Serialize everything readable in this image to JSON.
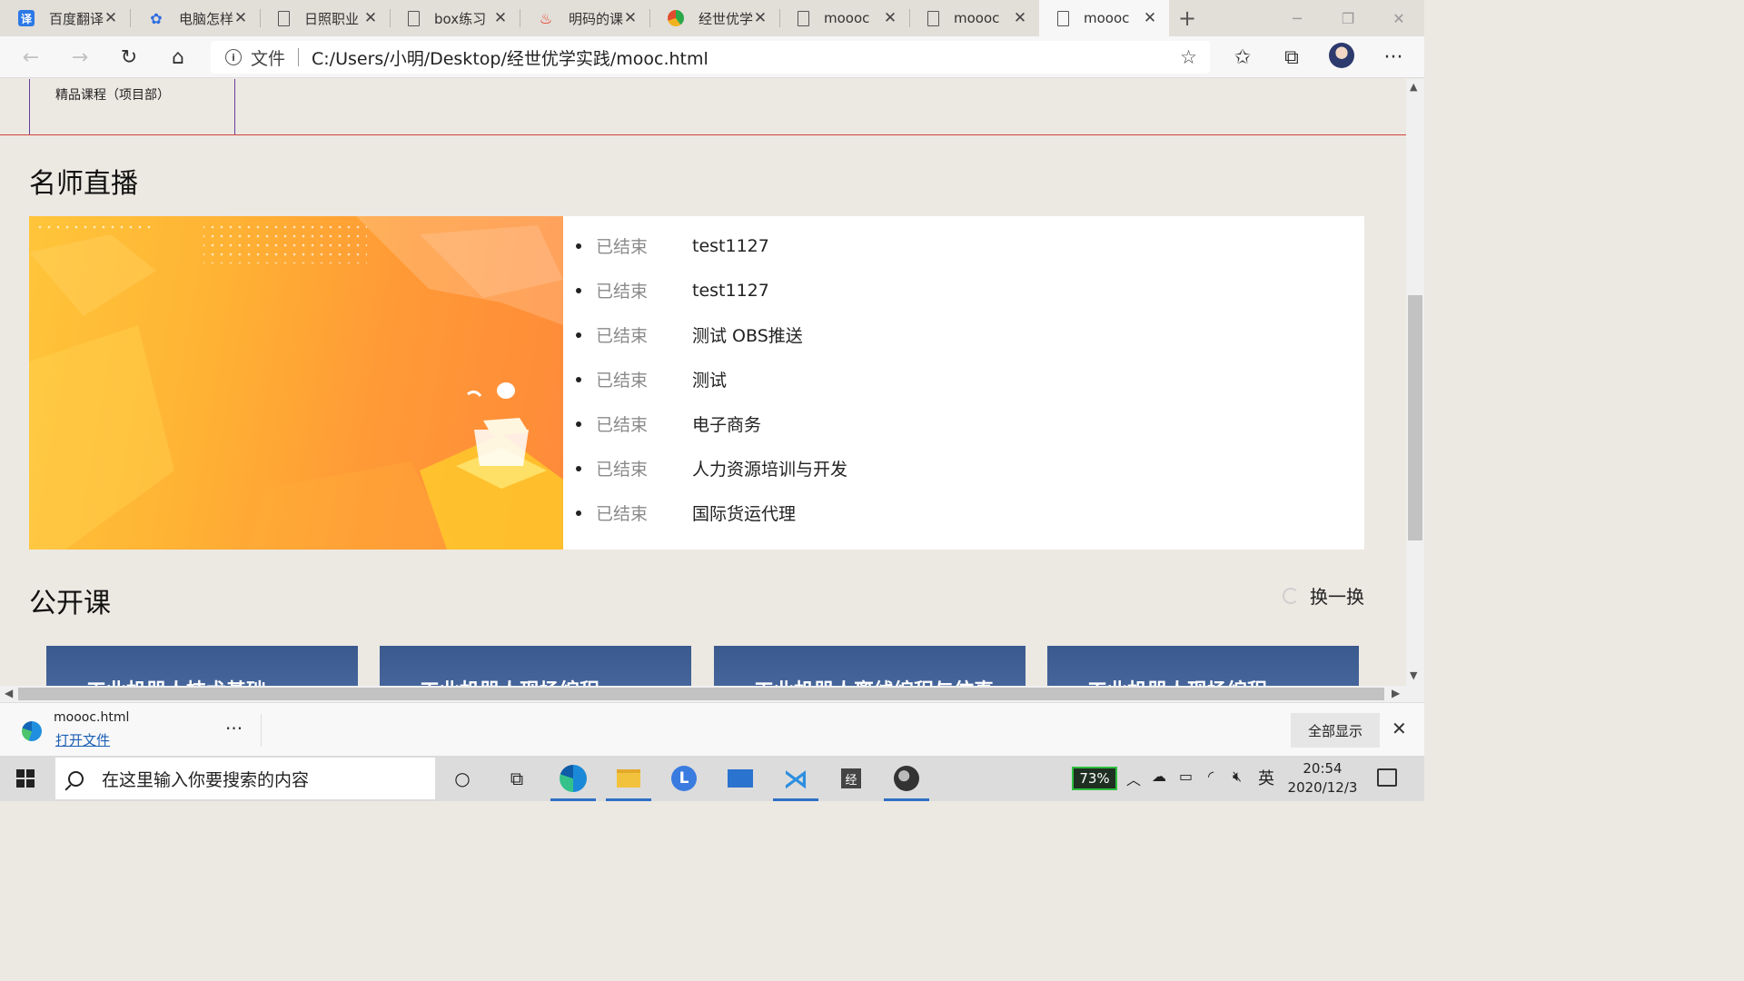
{
  "browser": {
    "tabs": [
      {
        "title": "百度翻译",
        "icon": "translate-icon"
      },
      {
        "title": "电脑怎样",
        "icon": "baidu-paw-icon"
      },
      {
        "title": "日照职业",
        "icon": "document-icon"
      },
      {
        "title": "box练习",
        "icon": "document-icon"
      },
      {
        "title": "明码的课",
        "icon": "fire-icon"
      },
      {
        "title": "经世优学",
        "icon": "swirl-logo-icon"
      },
      {
        "title": "moooc",
        "icon": "document-icon"
      },
      {
        "title": "moooc",
        "icon": "document-icon"
      },
      {
        "title": "moooc",
        "icon": "document-icon"
      }
    ],
    "new_tab_glyph": "+",
    "address": {
      "scheme_label": "文件",
      "url": "C:/Users/小明/Desktop/经世优学实践/mooc.html"
    }
  },
  "page": {
    "course_box_label": "精品课程（项目部）",
    "live_section_title": "名师直播",
    "live_items": [
      {
        "status": "已结束",
        "name": "test1127"
      },
      {
        "status": "已结束",
        "name": "test1127"
      },
      {
        "status": "已结束",
        "name": "测试 OBS推送"
      },
      {
        "status": "已结束",
        "name": "测试"
      },
      {
        "status": "已结束",
        "name": "电子商务"
      },
      {
        "status": "已结束",
        "name": "人力资源培训与开发"
      },
      {
        "status": "已结束",
        "name": "国际货运代理"
      }
    ],
    "open_section_title": "公开课",
    "refresh_label": "换一换",
    "cards": [
      {
        "title": "工业机器人技术基础"
      },
      {
        "title": "工业机器人现场编程"
      },
      {
        "title": "工业机器人离线编程与仿真"
      },
      {
        "title": "工业机器人现场编程"
      }
    ]
  },
  "download_bar": {
    "file_name": "moooc.html",
    "open_label": "打开文件",
    "more_glyph": "···",
    "show_all_label": "全部显示"
  },
  "taskbar": {
    "search_placeholder": "在这里输入你要搜索的内容",
    "battery_badge": "73%",
    "ime": "英",
    "time": "20:54",
    "date": "2020/12/3"
  },
  "colors": {
    "page_bg": "#ece8e2",
    "divider_red": "#d0443a",
    "course_box_border": "#6a3fa0",
    "banner_orange": "#ff9936"
  }
}
